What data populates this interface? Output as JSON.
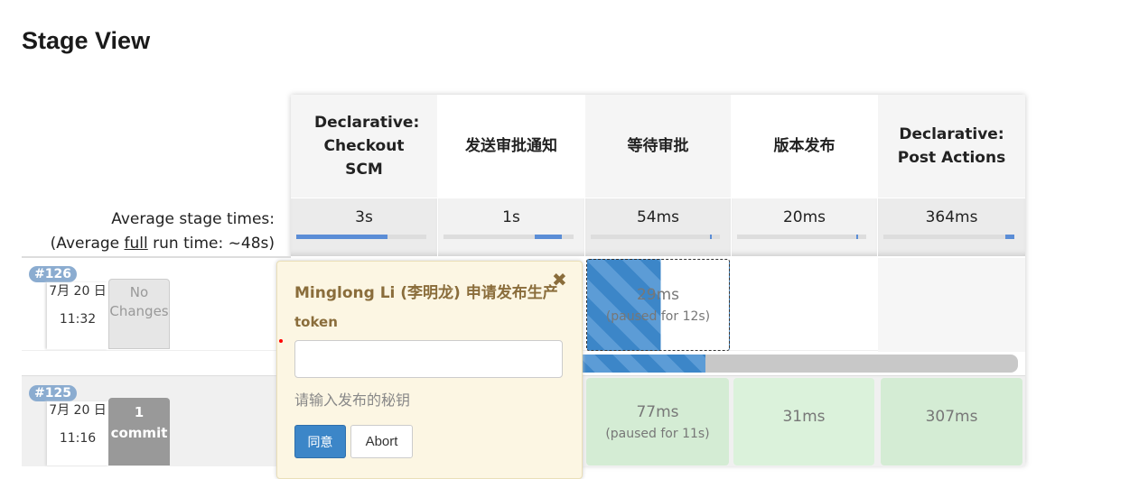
{
  "title": "Stage View",
  "stages": [
    "Declarative: Checkout SCM",
    "发送审批通知",
    "等待审批",
    "版本发布",
    "Declarative: Post Actions"
  ],
  "avg_label": "Average stage times:",
  "avg_full_prefix": "(Average ",
  "avg_full_link": "full",
  "avg_full_suffix": " run time: ~48s)",
  "avg_times": [
    "3s",
    "1s",
    "54ms",
    "20ms",
    "364ms"
  ],
  "builds": [
    {
      "number": "#126",
      "date": "7月 20 日",
      "time": "11:32",
      "changes": "No Changes",
      "cells": [
        "",
        "",
        "29ms",
        "",
        ""
      ],
      "paused": "(paused for 12s)",
      "progress_percent": 57
    },
    {
      "number": "#125",
      "date": "7月 20 日",
      "time": "11:16",
      "changes_count": "1",
      "changes": "commit",
      "cells": [
        "",
        "",
        "77ms",
        "31ms",
        "307ms"
      ],
      "paused": "(paused for 11s)"
    }
  ],
  "popup": {
    "title": "Minglong Li (李明龙) 申请发布生产",
    "field_label": "token",
    "field_value": "",
    "hint": "请输入发布的秘钥",
    "approve": "同意",
    "abort": "Abort",
    "close_icon": "close-icon"
  },
  "colors": {
    "running": "#3c86c8",
    "success": "#d4ecd4",
    "popup_bg": "#fcf6e3",
    "popup_title": "#8a6d3b"
  }
}
